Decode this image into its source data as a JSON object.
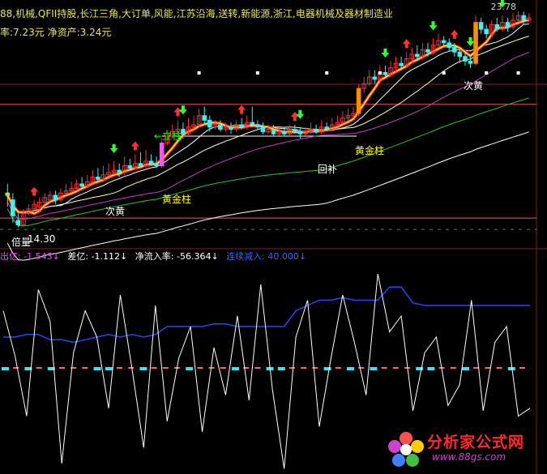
{
  "header": {
    "concepts": "88,机械,QFII持股,长江三角,大订单,风能,江苏沿海,送转,新能源,浙江,电器机械及器材制造业",
    "finance": "率:7.23元  净资产:3.24元",
    "price_top": "23.78"
  },
  "annotations": [
    {
      "text": "←立柱",
      "color": "#00ff00",
      "bar": 29
    },
    {
      "text": "黄金柱",
      "color": "#ffff00",
      "bar": 29
    },
    {
      "text": "次黄",
      "color": "#ffffff",
      "bar": 18
    },
    {
      "text": "倍量",
      "color": "#ffffff",
      "bar": 1
    },
    {
      "text": "14.30",
      "color": "#ffffff",
      "bar": 3
    },
    {
      "text": "黄金柱",
      "color": "#ffff00",
      "bar": 66
    },
    {
      "text": "回补",
      "color": "#ffffff",
      "bar": 61
    },
    {
      "text": "次黄",
      "color": "#ffffff",
      "bar": 88
    }
  ],
  "indicator_legend": [
    {
      "text": "出亿: -1.543↓",
      "color": "#ff40ff"
    },
    {
      "text": "差亿: -1.112↓",
      "color": "#ffffff"
    },
    {
      "text": "净流入率: -56.364↓",
      "color": "#ffffff"
    },
    {
      "text": "连续减入: 40.000↓",
      "color": "#4060ff"
    }
  ],
  "watermark": {
    "cn": "分析家公式网",
    "url": "www.88gs.com"
  },
  "chart_data": {
    "type": "candlestick",
    "price_axis": {
      "min": 13.6,
      "max": 24.0
    },
    "price_top_label": 23.78,
    "price_low_label": 14.3,
    "colors": {
      "up": "#ff3030",
      "down": "#40f0f0",
      "ma5": "#ff2020",
      "ma5_hi": "#ffff30",
      "ma10": "#ffffff",
      "ma20": "#ffffc0",
      "ma30": "#c040c0",
      "ma60": "#30c030",
      "ma120": "#ffffff",
      "level_line": "#ff5050"
    },
    "candles": [
      [
        15.8,
        15.7,
        16.2,
        15.2
      ],
      [
        15.5,
        14.8,
        15.8,
        14.5
      ],
      [
        14.6,
        14.4,
        14.9,
        14.3
      ],
      [
        14.4,
        14.9,
        15.1,
        14.3
      ],
      [
        14.9,
        15.1,
        15.3,
        14.8
      ],
      [
        15.1,
        15.3,
        15.5,
        14.9
      ],
      [
        15.2,
        15.4,
        15.6,
        15.0
      ],
      [
        15.4,
        15.6,
        15.8,
        15.3
      ],
      [
        15.5,
        15.7,
        15.9,
        15.4
      ],
      [
        15.7,
        15.5,
        15.9,
        15.3
      ],
      [
        15.5,
        15.8,
        16.0,
        15.4
      ],
      [
        15.8,
        15.9,
        16.2,
        15.7
      ],
      [
        15.9,
        16.0,
        16.3,
        15.8
      ],
      [
        16.0,
        16.2,
        16.4,
        15.9
      ],
      [
        16.2,
        16.1,
        16.5,
        16.0
      ],
      [
        16.1,
        16.3,
        16.6,
        16.0
      ],
      [
        16.3,
        16.5,
        16.8,
        16.2
      ],
      [
        16.5,
        16.4,
        16.9,
        16.3
      ],
      [
        16.4,
        16.6,
        17.0,
        16.3
      ],
      [
        16.6,
        16.7,
        17.1,
        16.5
      ],
      [
        16.7,
        16.8,
        17.2,
        16.6
      ],
      [
        16.8,
        16.7,
        17.1,
        16.5
      ],
      [
        16.7,
        17.0,
        17.4,
        16.6
      ],
      [
        17.0,
        16.9,
        17.3,
        16.8
      ],
      [
        16.9,
        17.1,
        17.5,
        16.8
      ],
      [
        17.1,
        17.0,
        17.6,
        16.9
      ],
      [
        17.0,
        17.2,
        17.7,
        16.9
      ],
      [
        17.2,
        17.1,
        17.5,
        17.0
      ],
      [
        17.1,
        17.0,
        17.4,
        16.9
      ],
      [
        17.0,
        18.0,
        18.2,
        16.9
      ],
      [
        18.0,
        18.3,
        18.6,
        17.9
      ],
      [
        18.3,
        18.5,
        18.8,
        18.2
      ],
      [
        18.5,
        18.6,
        19.0,
        18.3
      ],
      [
        18.6,
        18.4,
        18.9,
        18.2
      ],
      [
        18.4,
        18.7,
        19.1,
        18.3
      ],
      [
        18.7,
        18.8,
        19.2,
        18.5
      ],
      [
        18.8,
        19.2,
        19.5,
        18.7
      ],
      [
        19.2,
        19.0,
        19.6,
        18.8
      ],
      [
        19.0,
        18.7,
        19.2,
        18.5
      ],
      [
        18.7,
        18.8,
        19.0,
        18.6
      ],
      [
        18.8,
        18.6,
        19.0,
        18.5
      ],
      [
        18.6,
        18.7,
        18.9,
        18.5
      ],
      [
        18.7,
        18.6,
        18.9,
        18.4
      ],
      [
        18.6,
        18.8,
        19.0,
        18.5
      ],
      [
        18.8,
        18.7,
        19.1,
        18.6
      ],
      [
        18.7,
        18.9,
        19.2,
        18.6
      ],
      [
        18.9,
        18.8,
        19.6,
        18.7
      ],
      [
        18.8,
        18.7,
        19.0,
        18.6
      ],
      [
        18.7,
        18.5,
        18.9,
        18.4
      ],
      [
        18.5,
        18.6,
        18.8,
        18.4
      ],
      [
        18.6,
        18.4,
        18.8,
        18.3
      ],
      [
        18.4,
        18.5,
        18.7,
        18.3
      ],
      [
        18.5,
        18.4,
        18.7,
        18.3
      ],
      [
        18.4,
        18.6,
        18.8,
        18.3
      ],
      [
        18.6,
        18.5,
        18.8,
        18.4
      ],
      [
        18.5,
        18.4,
        18.7,
        18.2
      ],
      [
        18.4,
        18.5,
        18.7,
        18.3
      ],
      [
        18.5,
        18.6,
        18.9,
        18.4
      ],
      [
        18.6,
        18.5,
        18.8,
        18.4
      ],
      [
        18.5,
        18.7,
        19.0,
        18.4
      ],
      [
        18.7,
        18.6,
        18.9,
        18.5
      ],
      [
        18.6,
        18.8,
        19.1,
        18.5
      ],
      [
        18.8,
        18.9,
        19.2,
        18.7
      ],
      [
        18.9,
        19.1,
        19.4,
        18.8
      ],
      [
        19.1,
        19.2,
        19.5,
        19.0
      ],
      [
        19.2,
        19.3,
        19.6,
        19.1
      ],
      [
        19.3,
        20.4,
        20.6,
        19.2
      ],
      [
        20.4,
        20.6,
        20.9,
        20.2
      ],
      [
        20.6,
        20.9,
        21.2,
        20.5
      ],
      [
        20.9,
        20.8,
        21.2,
        20.6
      ],
      [
        20.8,
        21.1,
        21.4,
        20.7
      ],
      [
        21.1,
        21.0,
        21.4,
        20.9
      ],
      [
        21.0,
        21.3,
        21.6,
        20.9
      ],
      [
        21.3,
        21.5,
        21.8,
        21.1
      ],
      [
        21.5,
        21.4,
        21.8,
        21.2
      ],
      [
        21.4,
        21.7,
        22.0,
        21.3
      ],
      [
        21.7,
        21.9,
        22.2,
        21.5
      ],
      [
        21.9,
        21.8,
        22.3,
        21.6
      ],
      [
        21.8,
        22.1,
        22.4,
        21.7
      ],
      [
        22.1,
        22.0,
        22.4,
        21.8
      ],
      [
        22.0,
        22.3,
        22.6,
        21.9
      ],
      [
        22.3,
        22.5,
        22.8,
        22.2
      ],
      [
        22.5,
        22.4,
        22.7,
        22.2
      ],
      [
        22.4,
        22.2,
        22.6,
        22.0
      ],
      [
        22.2,
        22.0,
        22.4,
        21.8
      ],
      [
        22.0,
        21.8,
        22.2,
        21.5
      ],
      [
        21.8,
        21.6,
        22.0,
        21.4
      ],
      [
        21.6,
        21.5,
        21.9,
        21.3
      ],
      [
        21.5,
        23.3,
        23.6,
        21.4
      ],
      [
        23.3,
        23.0,
        23.5,
        22.8
      ],
      [
        23.0,
        22.8,
        23.2,
        22.6
      ],
      [
        22.8,
        23.2,
        23.4,
        22.7
      ],
      [
        23.2,
        23.0,
        23.5,
        22.9
      ],
      [
        23.0,
        23.3,
        23.6,
        22.9
      ],
      [
        23.3,
        23.1,
        23.5,
        22.9
      ],
      [
        23.1,
        23.4,
        23.7,
        23.0
      ],
      [
        23.4,
        23.6,
        23.78,
        23.3
      ],
      [
        23.6,
        23.4,
        23.78,
        23.2
      ],
      [
        23.4,
        23.5,
        23.7,
        23.3
      ]
    ],
    "up_arrow_bars": [
      5,
      24,
      32,
      44,
      54,
      75,
      84
    ],
    "down_arrow_bars": [
      20,
      33,
      55,
      71,
      80,
      87,
      93
    ],
    "white_dot_bars": [
      36,
      47,
      60,
      70,
      82,
      90,
      96
    ],
    "indicator": {
      "range": [
        -4.0,
        4.0
      ],
      "white_line": [
        2.2,
        0.5,
        -1.8,
        3.0,
        1.8,
        -3.6,
        0.6,
        2.2,
        1.2,
        -1.5,
        2.8,
        0.0,
        -3.0,
        2.4,
        -2.0,
        0.4,
        1.6,
        -2.4,
        0.8,
        -1.0,
        2.0,
        -1.2,
        3.2,
        -0.8,
        -3.8,
        1.2,
        2.6,
        -2.2,
        0.4,
        2.8,
        1.0,
        -1.0,
        3.6,
        1.4,
        2.0,
        -1.6,
        0.6,
        1.2,
        -1.4,
        -0.6,
        2.6,
        -1.6,
        1.0,
        1.6,
        -1.8,
        -1.5
      ],
      "blue_line": [
        1.2,
        1.2,
        1.3,
        1.3,
        1.1,
        1.1,
        1.0,
        1.1,
        1.2,
        1.3,
        1.2,
        1.3,
        1.2,
        1.3,
        1.6,
        1.6,
        1.6,
        1.6,
        1.7,
        1.7,
        1.6,
        1.6,
        1.6,
        1.6,
        1.6,
        2.2,
        2.4,
        2.6,
        2.6,
        2.7,
        2.6,
        2.6,
        2.6,
        3.1,
        3.1,
        2.5,
        2.4,
        2.4,
        2.4,
        2.4,
        2.4,
        2.4,
        2.4,
        2.4,
        2.4,
        2.4
      ],
      "zero_marks": 46
    }
  }
}
